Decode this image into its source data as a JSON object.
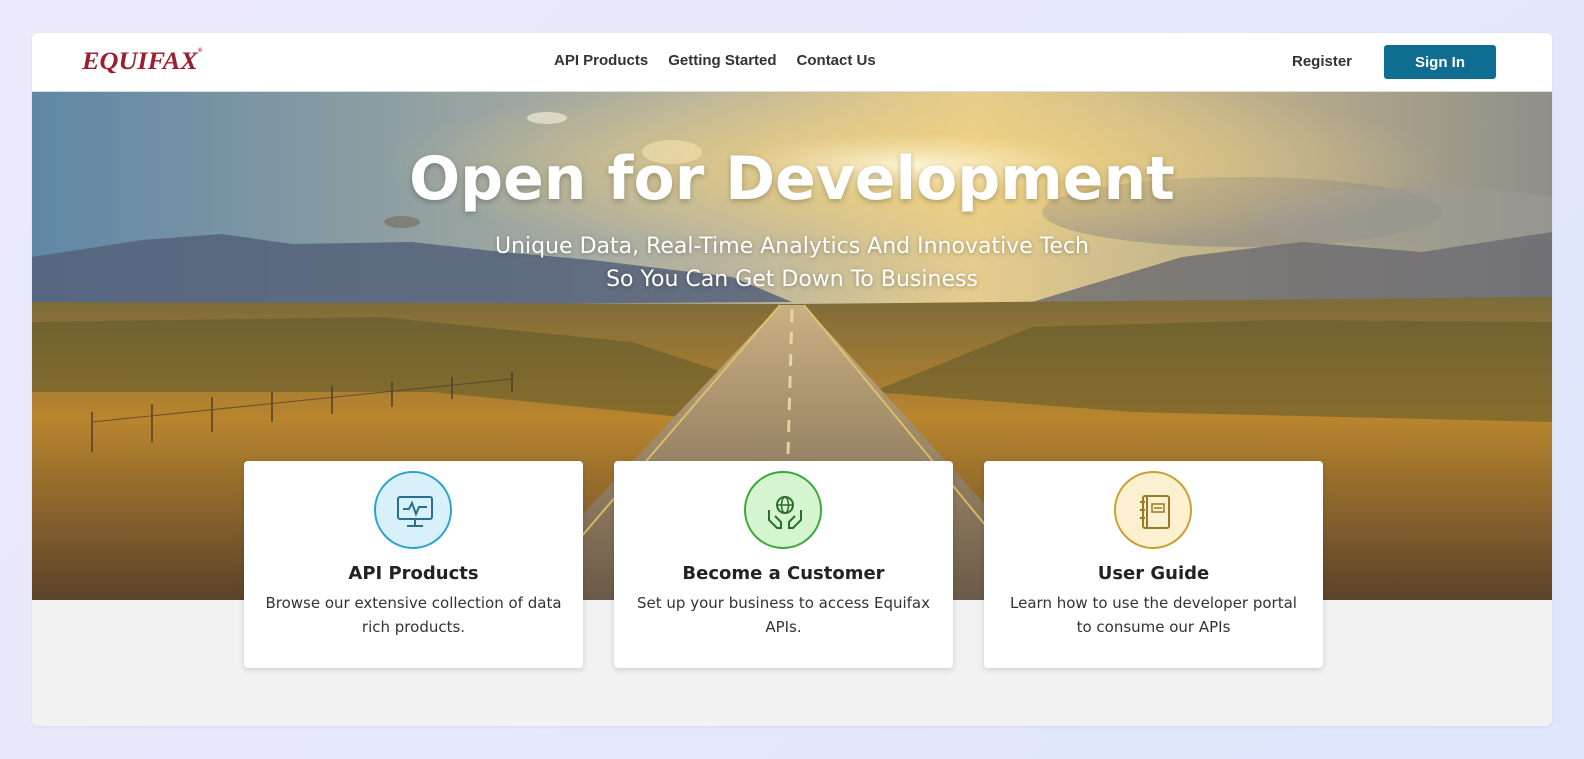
{
  "header": {
    "logo_text": "EQUIFAX",
    "nav": [
      "API Products",
      "Getting Started",
      "Contact Us"
    ],
    "register_label": "Register",
    "signin_label": "Sign In"
  },
  "hero": {
    "title": "Open for Development",
    "subtitle_line1": "Unique Data, Real-Time Analytics And Innovative Tech",
    "subtitle_line2": "So You Can Get Down To Business"
  },
  "cards": [
    {
      "title": "API Products",
      "desc": "Browse our extensive collection of data rich products.",
      "icon": "monitor-icon",
      "color": "#2aa3d1"
    },
    {
      "title": "Become a Customer",
      "desc": "Set up your business to access Equifax APIs.",
      "icon": "globe-hands-icon",
      "color": "#3aa83a"
    },
    {
      "title": "User Guide",
      "desc": "Learn how to use the developer portal to consume our APIs",
      "icon": "guide-book-icon",
      "color": "#c9a02e"
    }
  ],
  "colors": {
    "brand": "#9d1d2f",
    "primary_button": "#0f6d92"
  }
}
